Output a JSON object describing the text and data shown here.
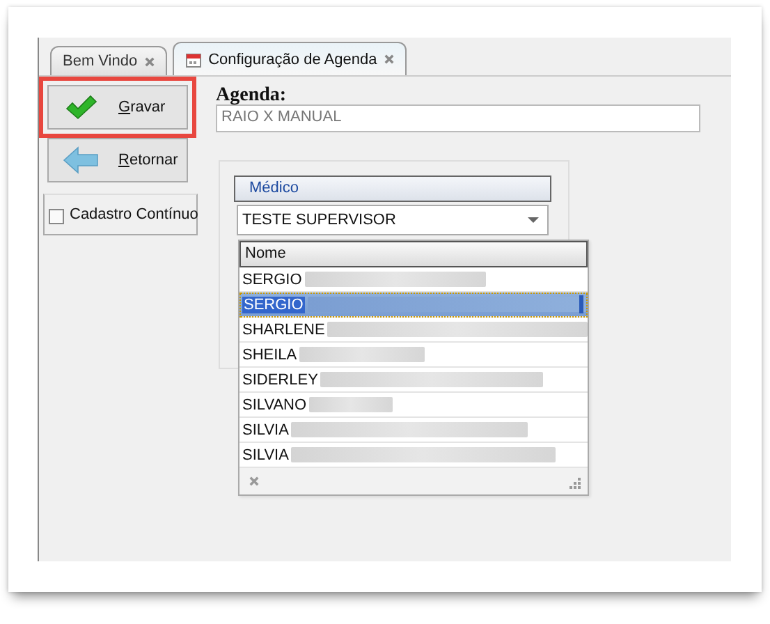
{
  "tabs": [
    {
      "label": "Bem Vindo",
      "selected": false,
      "icon": false
    },
    {
      "label": "Configuração de Agenda",
      "selected": true,
      "icon": true
    }
  ],
  "side_buttons": [
    {
      "label": "Gravar",
      "kind": "save",
      "highlighted": true
    },
    {
      "label": "Retornar",
      "kind": "back",
      "highlighted": false
    }
  ],
  "continuous_register": {
    "label": "Cadastro Contínuo",
    "checked": false
  },
  "agenda": {
    "label": "Agenda:",
    "value": "RAIO X MANUAL"
  },
  "doctor": {
    "label": "Médico",
    "value": "TESTE SUPERVISOR"
  },
  "dropdown": {
    "column": "Nome",
    "rows": [
      {
        "name": "SERGIO",
        "selected": false
      },
      {
        "name": "SERGIO",
        "selected": true
      },
      {
        "name": "SHARLENE",
        "selected": false
      },
      {
        "name": "SHEILA",
        "selected": false
      },
      {
        "name": "SIDERLEY",
        "selected": false
      },
      {
        "name": "SILVANO",
        "selected": false
      },
      {
        "name": "SILVIA",
        "selected": false
      },
      {
        "name": "SILVIA",
        "selected": false
      }
    ]
  }
}
